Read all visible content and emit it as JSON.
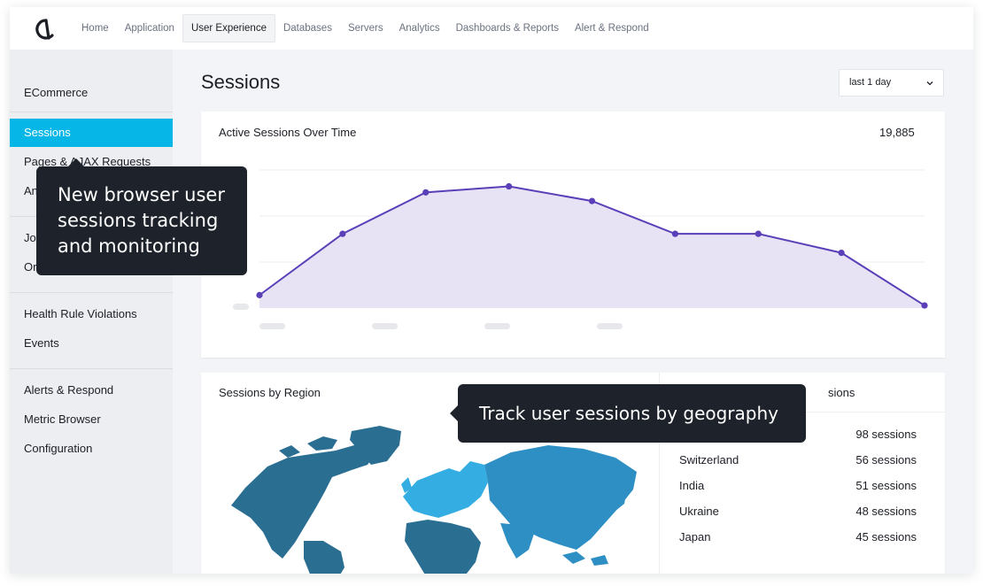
{
  "nav": {
    "items": [
      "Home",
      "Application",
      "User Experience",
      "Databases",
      "Servers",
      "Analytics",
      "Dashboards & Reports",
      "Alert & Respond"
    ],
    "active": "User Experience"
  },
  "sidebar": {
    "items": [
      "ECommerce",
      "Sessions",
      "Pages & AJAX Requests",
      "An",
      "Jo",
      "Or",
      "Health Rule Violations",
      "Events",
      "Alerts & Respond",
      "Metric Browser",
      "Configuration"
    ],
    "active": "Sessions"
  },
  "main": {
    "title": "Sessions",
    "range_select": "last 1 day"
  },
  "active_sessions": {
    "title": "Active Sessions Over Time",
    "total": "19,885"
  },
  "chart_data": {
    "type": "area",
    "title": "Active Sessions Over Time",
    "series": [
      {
        "values": [
          15,
          86,
          134,
          141,
          124,
          86,
          86,
          64,
          3
        ]
      }
    ],
    "ylim": [
      0,
      160
    ],
    "grid": true,
    "line_color": "#5a3fb8",
    "fill_color": "#e7e3f5"
  },
  "sessions_by_region": {
    "title": "Sessions by Region"
  },
  "sessions_by_country": {
    "title_visible_suffix": "sions",
    "rows": [
      {
        "country": "",
        "value": "98 sessions"
      },
      {
        "country": "Switzerland",
        "value": "56 sessions"
      },
      {
        "country": "India",
        "value": "51 sessions"
      },
      {
        "country": "Ukraine",
        "value": "48 sessions"
      },
      {
        "country": "Japan",
        "value": "45 sessions"
      }
    ]
  },
  "tooltips": {
    "sessions_tracking": "New browser user sessions tracking and monitoring",
    "geography": "Track user sessions by geography"
  },
  "colors": {
    "accent": "#06b6e6",
    "tooltip_bg": "#1d222b",
    "map_dark": "#2a6f92",
    "map_mid": "#2e8fc4",
    "map_light": "#34aee2"
  }
}
